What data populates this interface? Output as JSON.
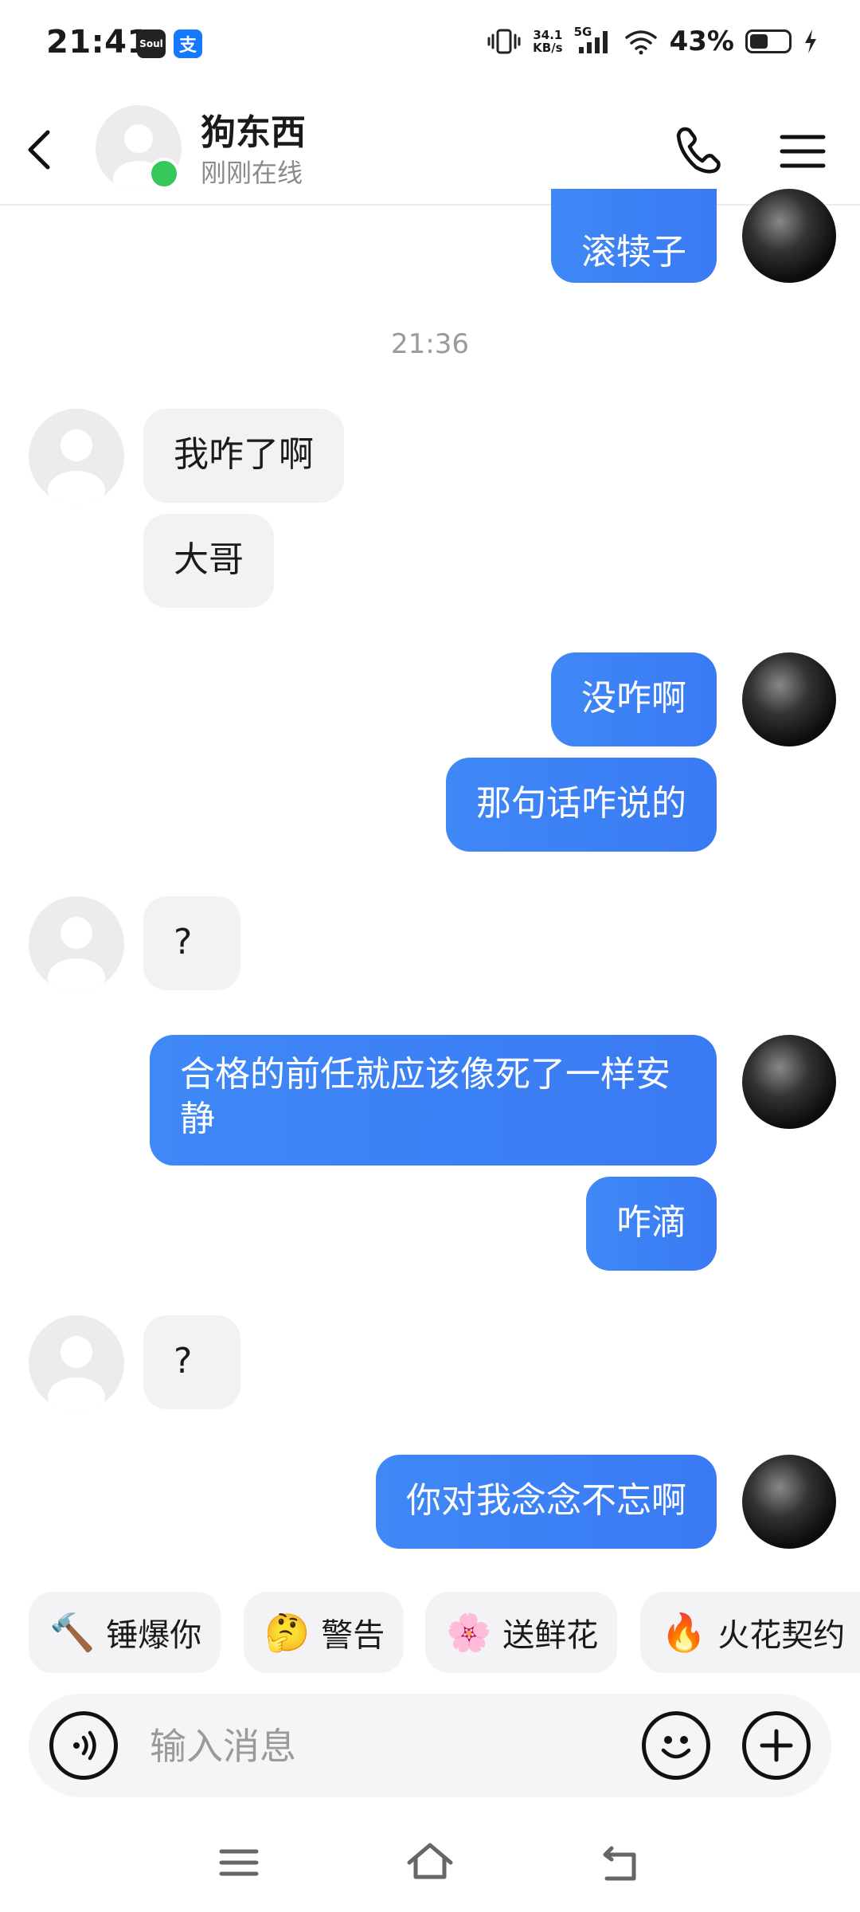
{
  "status_bar": {
    "time": "21:41",
    "app_icons": [
      "Soul",
      "支"
    ],
    "net_speed_value": "34.1",
    "net_speed_unit": "KB/s",
    "network": "5G",
    "battery": "43%"
  },
  "header": {
    "contact_name": "狗东西",
    "contact_status": "刚刚在线"
  },
  "chat": {
    "messages": [
      {
        "from": "me",
        "text": "滚犊子"
      },
      {
        "from": "peer",
        "text": "我咋了啊"
      },
      {
        "from": "peer",
        "text": "大哥"
      },
      {
        "from": "me",
        "text": "没咋啊"
      },
      {
        "from": "me",
        "text": "那句话咋说的"
      },
      {
        "from": "peer",
        "text": "?"
      },
      {
        "from": "me",
        "text": "合格的前任就应该像死了一样安静"
      },
      {
        "from": "me",
        "text": "咋滴"
      },
      {
        "from": "peer",
        "text": "?"
      },
      {
        "from": "me",
        "text": "你对我念念不忘啊"
      }
    ],
    "time_separator": "21:36"
  },
  "quick_actions": [
    {
      "label": "锤爆你",
      "icon": "hammer-icon",
      "emoji": "🔨"
    },
    {
      "label": "警告",
      "icon": "thinking-face-icon",
      "emoji": "🤔"
    },
    {
      "label": "送鲜花",
      "icon": "flower-icon",
      "emoji": "🌸"
    },
    {
      "label": "火花契约",
      "icon": "flame-icon",
      "emoji": "🔥"
    }
  ],
  "input": {
    "placeholder": "输入消息"
  },
  "colors": {
    "outgoing_bubble": "#3f88f6",
    "incoming_bubble": "#f2f2f2",
    "online_dot": "#35c759"
  }
}
